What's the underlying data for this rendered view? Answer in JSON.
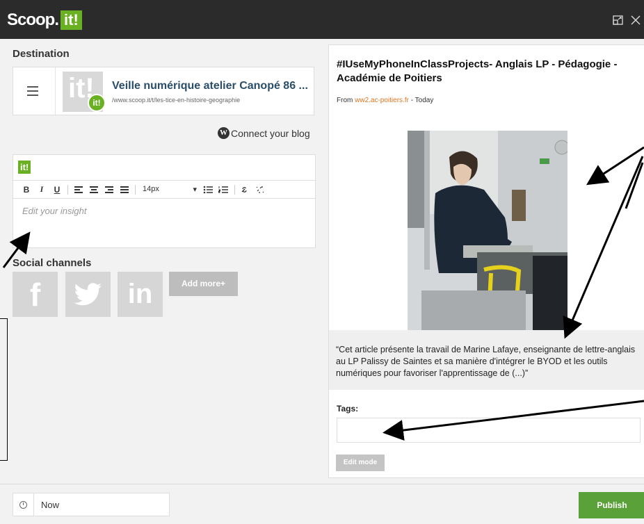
{
  "header": {
    "logo_text": "Scoop.",
    "logo_badge": "it!",
    "window_controls": [
      "expand-icon",
      "close-icon"
    ]
  },
  "destination": {
    "section_title": "Destination",
    "topic_name": "Veille numérique atelier Canopé 86 ...",
    "topic_url": "/www.scoop.it/t/les-tice-en-histoire-geographie",
    "thumb_text": "it!",
    "badge_text": "it!"
  },
  "connect_blog": {
    "label": "Connect your blog",
    "icon_glyph": "W"
  },
  "editor": {
    "badge": "it!",
    "toolbar": {
      "bold": "B",
      "italic": "I",
      "underline": "U",
      "font_size": "14px"
    },
    "placeholder": "Edit your insight"
  },
  "social": {
    "section_title": "Social channels",
    "facebook_glyph": "f",
    "linkedin_glyph": "in",
    "add_more_label": "Add more+"
  },
  "post": {
    "title": "#IUseMyPhoneInClassProjects- Anglais LP - Pédagogie - Académie de Poitiers",
    "from_label": "From",
    "source": "ww2.ac-poitiers.fr",
    "date": "- Today",
    "quote": "“Cet article présente la travail de Marine Lafaye, enseignante de lettre-anglais au LP Palissy de Saintes et sa manière d'intégrer le BYOD et les outils numériques pour favoriser l'apprentissage de (...)”",
    "tags_label": "Tags:",
    "edit_mode_label": "Edit mode"
  },
  "footer": {
    "schedule_value": "Now",
    "publish_label": "Publish"
  },
  "colors": {
    "brand_green": "#6ab023",
    "publish_green": "#5aa13a",
    "source_orange": "#e0741f",
    "topbar": "#2b2b2b"
  }
}
